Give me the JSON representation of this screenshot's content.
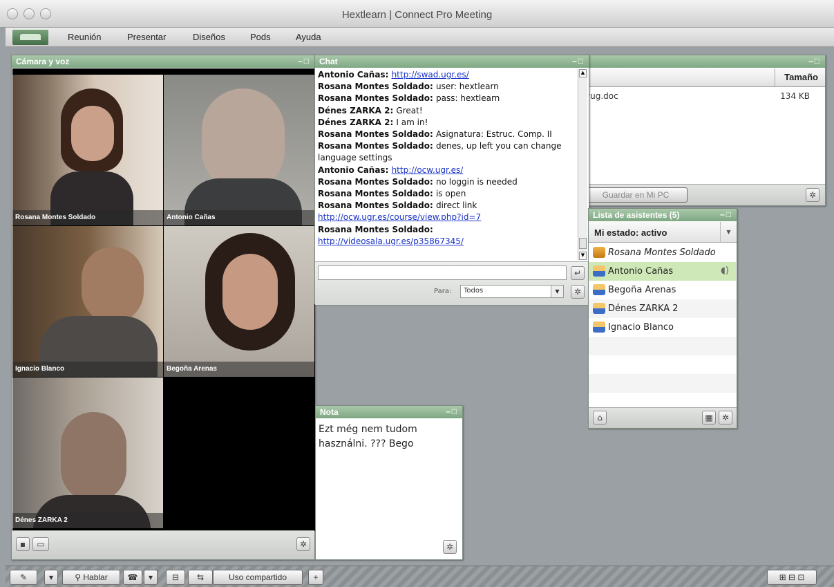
{
  "window": {
    "title": "Hextlearn | Connect Pro Meeting"
  },
  "menu": [
    "Reunión",
    "Presentar",
    "Diseños",
    "Pods",
    "Ayuda"
  ],
  "camera_pod": {
    "title": "Cámara y voz",
    "participants": [
      "Rosana Montes Soldado",
      "Antonio Cañas",
      "Ignacio Blanco",
      "Begoña Arenas",
      "Dénes ZARKA 2"
    ]
  },
  "chat_pod": {
    "title": "Chat",
    "messages": [
      {
        "who": "Antonio Cañas:",
        "text": "http://swad.ugr.es/",
        "link": true
      },
      {
        "who": "Rosana Montes Soldado:",
        "text": "user: hextlearn",
        "link": false
      },
      {
        "who": "Rosana Montes Soldado:",
        "text": "pass: hextlearn",
        "link": false
      },
      {
        "who": "Dénes ZARKA 2:",
        "text": "Great!",
        "link": false
      },
      {
        "who": "Dénes ZARKA 2:",
        "text": "I am in!",
        "link": false
      },
      {
        "who": "Rosana Montes Soldado:",
        "text": "Asignatura: Estruc. Comp. II",
        "link": false
      },
      {
        "who": "Rosana Montes Soldado:",
        "text": "denes, up left you can change language settings",
        "link": false
      },
      {
        "who": "Antonio Cañas:",
        "text": "http://ocw.ugr.es/",
        "link": true
      },
      {
        "who": "Rosana Montes Soldado:",
        "text": "no loggin is needed",
        "link": false
      },
      {
        "who": "Rosana Montes Soldado:",
        "text": "is open",
        "link": false
      },
      {
        "who": "Rosana Montes Soldado:",
        "text": "direct link",
        "link": false
      },
      {
        "who": "",
        "text": "http://ocw.ugr.es/course/view.php?id=7",
        "link": true
      },
      {
        "who": "Rosana Montes Soldado:",
        "text": "",
        "link": false
      },
      {
        "who": "",
        "text": "http://videosala.ugr.es/p35867345/",
        "link": true
      }
    ],
    "to_label": "Para:",
    "to_value": "Todos"
  },
  "files_pod": {
    "column_header": "Tamaño",
    "file_name": "vug.doc",
    "file_size": "134 KB",
    "save_button": "Guardar en Mi PC"
  },
  "attendees_pod": {
    "title": "Lista de asistentes (5)",
    "status": "Mi estado: activo",
    "attendees": [
      "Rosana Montes Soldado",
      "Antonio Cañas",
      "Begoña Arenas",
      "Dénes ZARKA 2",
      "Ignacio Blanco"
    ]
  },
  "note_pod": {
    "title": "Nota",
    "text": "Ezt még nem tudom használni. ??? Bego"
  },
  "toolbar": {
    "talk": "Hablar",
    "share": "Uso compartido"
  },
  "colors": {
    "pod_header": "#8fb48f",
    "link": "#1a33c8",
    "background": "#9aa0a3"
  }
}
